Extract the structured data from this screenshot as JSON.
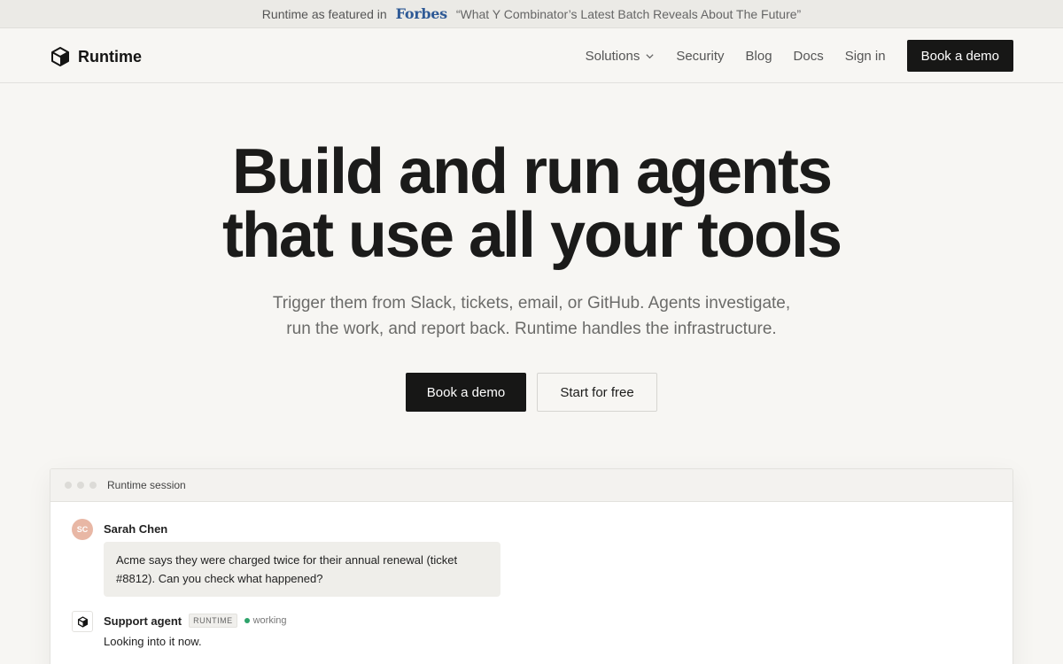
{
  "announcement": {
    "prefix": "Runtime as featured in",
    "brand": "Forbes",
    "quote": "“What Y Combinator’s Latest Batch Reveals About The Future”"
  },
  "nav": {
    "logo_text": "Runtime",
    "logo_icon": "cube-icon",
    "links": [
      {
        "label": "Solutions",
        "has_dropdown": true
      },
      {
        "label": "Security"
      },
      {
        "label": "Blog"
      },
      {
        "label": "Docs"
      },
      {
        "label": "Sign in"
      }
    ],
    "cta": "Book a demo"
  },
  "hero": {
    "title_line1": "Build and run agents",
    "title_line2": "that use all your tools",
    "subtitle_line1": "Trigger them from Slack, tickets, email, or GitHub. Agents investigate,",
    "subtitle_line2": "run the work, and report back. Runtime handles the infrastructure.",
    "primary_button": "Book a demo",
    "secondary_button": "Start for free"
  },
  "session": {
    "title": "Runtime session",
    "messages": [
      {
        "avatar_initials": "SC",
        "name": "Sarah Chen",
        "text": "Acme says they were charged twice for their annual renewal (ticket #8812). Can you check what happened?"
      },
      {
        "name": "Support agent",
        "tag": "RUNTIME",
        "status": "working",
        "status_color": "#2ea36b",
        "text": "Looking into it now."
      }
    ]
  },
  "colors": {
    "background": "#f7f6f3",
    "announcement_bg": "#ebeae6",
    "primary_button": "#171716",
    "forbes_blue": "#2f5a96",
    "avatar_bg": "#e8b7a5"
  }
}
